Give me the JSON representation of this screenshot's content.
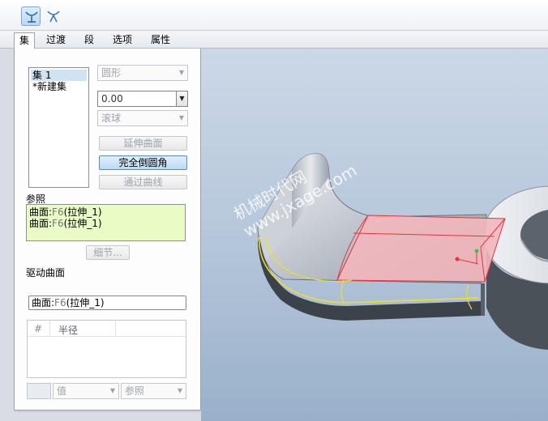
{
  "toolbar": {
    "tool1_icon": "fillet-set-mode-icon",
    "tool2_icon": "fillet-transition-mode-icon"
  },
  "tabs": [
    {
      "label": "集",
      "active": true
    },
    {
      "label": "过渡",
      "active": false
    },
    {
      "label": "段",
      "active": false
    },
    {
      "label": "选项",
      "active": false
    },
    {
      "label": "属性",
      "active": false
    }
  ],
  "panel": {
    "sets": [
      {
        "label": "集 1",
        "selected": true
      },
      {
        "label": "*新建集",
        "selected": false
      }
    ],
    "shape_dropdown": "圆形",
    "radius_value": "0.00",
    "method_dropdown": "滚球",
    "buttons": {
      "extend_surface": "延伸曲面",
      "full_round": "完全倒圆角",
      "through_curve": "通过曲线",
      "details": "细节..."
    },
    "references_label": "参照",
    "references": [
      {
        "prefix": "曲面:",
        "id": "F6",
        "name": "(拉伸_1)"
      },
      {
        "prefix": "曲面:",
        "id": "F6",
        "name": "(拉伸_1)"
      }
    ],
    "driving_surface_label": "驱动曲面",
    "driving_surface": {
      "prefix": "曲面:",
      "id": "F6",
      "name": "(拉伸_1)"
    },
    "radius_table": {
      "columns": [
        "#",
        "半径"
      ]
    },
    "value_dropdown": "值",
    "reference_dropdown": "参照"
  },
  "viewport": {
    "watermark_line1": "机械时代网",
    "watermark_line2": "www.jxage.com"
  },
  "colors": {
    "selection_fill": "#f2b7bc",
    "selection_edge": "#e8323c",
    "highlight_edge": "#f0e020",
    "references_bg": "#e9fcc6"
  }
}
